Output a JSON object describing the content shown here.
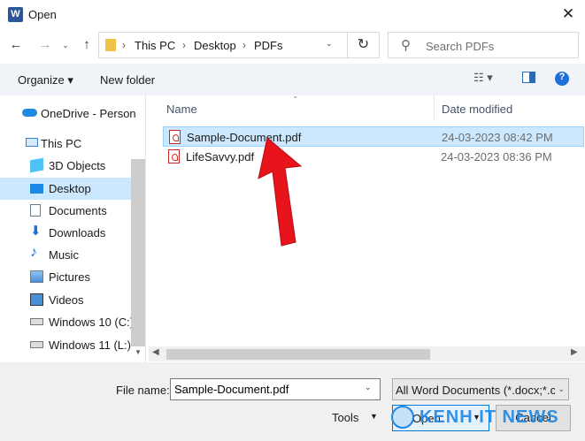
{
  "window": {
    "title": "Open",
    "app_icon": "W",
    "close_symbol": "✕"
  },
  "nav": {
    "back": "←",
    "forward": "→",
    "recent": "⌄",
    "up": "↑",
    "breadcrumb": [
      "This PC",
      "Desktop",
      "PDFs"
    ],
    "sep": "›",
    "refresh": "↻",
    "search_placeholder": "Search PDFs"
  },
  "toolbar": {
    "organize": "Organize ▾",
    "new_folder": "New folder",
    "view": "☷ ▾",
    "help": "?"
  },
  "sidebar": {
    "items": [
      {
        "label": "OneDrive - Person",
        "icon": "onedrive-icon"
      },
      {
        "label": "This PC",
        "icon": "this-pc-icon"
      },
      {
        "label": "3D Objects",
        "icon": "3d-objects-icon"
      },
      {
        "label": "Desktop",
        "icon": "desktop-icon",
        "selected": true
      },
      {
        "label": "Documents",
        "icon": "documents-icon"
      },
      {
        "label": "Downloads",
        "icon": "downloads-icon"
      },
      {
        "label": "Music",
        "icon": "music-icon"
      },
      {
        "label": "Pictures",
        "icon": "pictures-icon"
      },
      {
        "label": "Videos",
        "icon": "videos-icon"
      },
      {
        "label": "Windows 10 (C:)",
        "icon": "drive-icon"
      },
      {
        "label": "Windows 11 (L:)",
        "icon": "drive-icon"
      }
    ]
  },
  "files": {
    "columns": [
      "Name",
      "Date modified"
    ],
    "rows": [
      {
        "name": "Sample-Document.pdf",
        "date": "24-03-2023 08:42 PM",
        "selected": true
      },
      {
        "name": "LifeSavvy.pdf",
        "date": "24-03-2023 08:36 PM",
        "selected": false
      }
    ]
  },
  "bottom": {
    "file_name_label": "File name:",
    "file_name_value": "Sample-Document.pdf",
    "file_type": "All Word Documents (*.docx;*.c",
    "tools": "Tools",
    "open": "Open",
    "cancel": "Cancel"
  },
  "watermark": "KENH IT NEWS",
  "colors": {
    "accent": "#0078d7",
    "selection": "#cce8ff",
    "arrow": "#e8141c"
  }
}
